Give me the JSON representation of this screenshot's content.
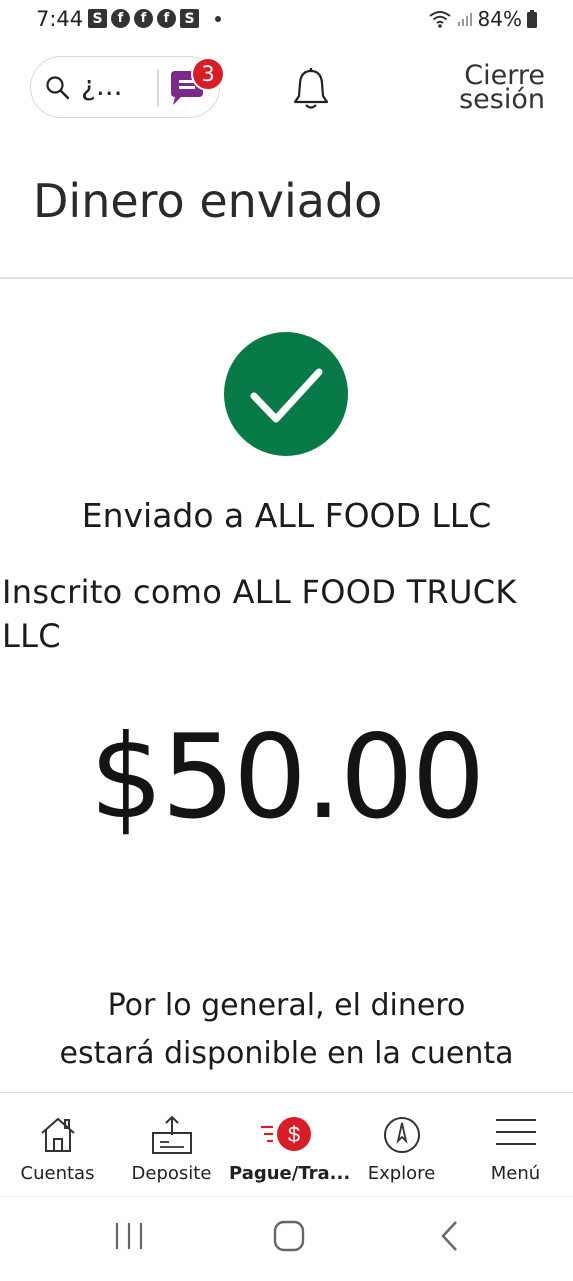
{
  "status_bar": {
    "time": "7:44",
    "notif_letters": [
      "S",
      "f",
      "f",
      "f",
      "S"
    ],
    "battery": "84%"
  },
  "header": {
    "search_text": "¿...",
    "badge_count": "3",
    "signout_line1": "Cierre",
    "signout_line2": "sesión"
  },
  "page": {
    "title": "Dinero enviado",
    "sent_to": "Enviado a ALL FOOD LLC",
    "enrolled_as": "Inscrito como ALL FOOD TRUCK LLC",
    "amount": "$50.00",
    "note_line1": "Por lo general, el dinero",
    "note_line2": "estará disponible en la cuenta"
  },
  "bottom_nav": {
    "items": [
      {
        "label": "Cuentas",
        "icon": "house-icon"
      },
      {
        "label": "Deposite",
        "icon": "deposit-icon"
      },
      {
        "label": "Pague/Tra...",
        "icon": "pay-transfer-icon",
        "active": true
      },
      {
        "label": "Explore",
        "icon": "compass-icon"
      },
      {
        "label": "Menú",
        "icon": "hamburger-icon"
      }
    ]
  },
  "colors": {
    "success_green": "#087a48",
    "badge_red": "#d71e28",
    "chat_purple": "#7b2a8a"
  }
}
